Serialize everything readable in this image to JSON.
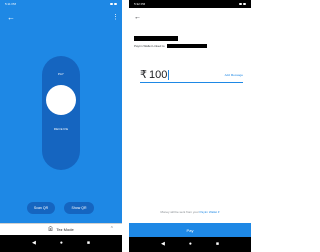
{
  "left_screen": {
    "status_time": "5:11 PM",
    "slider_top_label": "PAY",
    "slider_bottom_label": "RECEIVE",
    "scan_qr_label": "Scan QR",
    "show_qr_label": "Show QR",
    "tez_mode_label": "Tez Mode",
    "icons": {
      "back": "back-arrow-icon",
      "menu": "more-vert-icon",
      "tez": "tez-mode-icon",
      "expand": "chevron-up-icon"
    }
  },
  "right_screen": {
    "status_time": "5:32 PM",
    "wallet_text": "Paytm Wallet Linked to",
    "currency_symbol": "₹",
    "amount": "100",
    "add_message_label": "Add Message",
    "sent_note_prefix": "Money will be sent from your",
    "sent_note_link": "Paytm Wallet",
    "sent_note_suffix": "▾",
    "pay_label": "Pay"
  },
  "nav": {
    "back": "◀",
    "home": "●",
    "recents": "■"
  },
  "colors": {
    "tez_blue": "#1e88e5",
    "tez_dark_blue": "#1565c0"
  }
}
